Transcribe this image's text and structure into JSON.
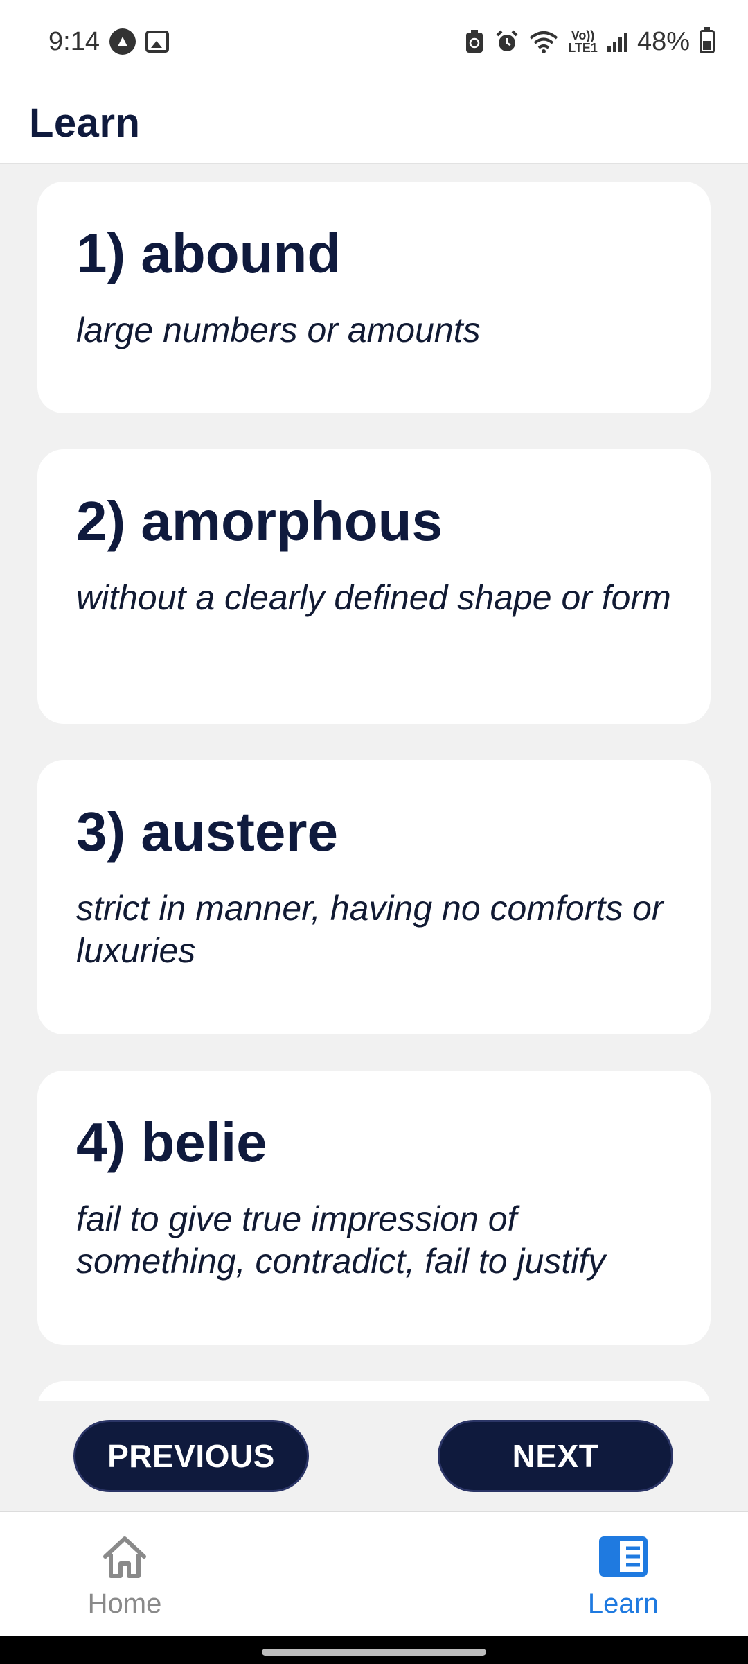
{
  "status_bar": {
    "time": "9:14",
    "lte_top": "Vo))",
    "lte_bottom": "LTE1",
    "battery": "48%",
    "icons": [
      "a-circle-icon",
      "image-icon",
      "battery-saver-icon",
      "alarm-icon",
      "wifi-icon",
      "signal-icon",
      "battery-icon"
    ]
  },
  "app_bar": {
    "title": "Learn"
  },
  "words": [
    {
      "title": "1) abound",
      "definition": "large numbers or amounts"
    },
    {
      "title": "2) amorphous",
      "definition": "without a clearly defined shape or form"
    },
    {
      "title": "3) austere",
      "definition": "strict in manner, having no comforts or luxuries"
    },
    {
      "title": "4) belie",
      "definition": "fail to give true impression of something, contradict, fail to justify"
    }
  ],
  "nav_buttons": {
    "previous": "PREVIOUS",
    "next": "NEXT"
  },
  "bottom_nav": {
    "home": "Home",
    "learn": "Learn",
    "active": "learn",
    "active_color": "#1f7ae0",
    "inactive_color": "#8a8a8a"
  },
  "colors": {
    "primary": "#0f1a3d",
    "background": "#f1f1f1"
  }
}
